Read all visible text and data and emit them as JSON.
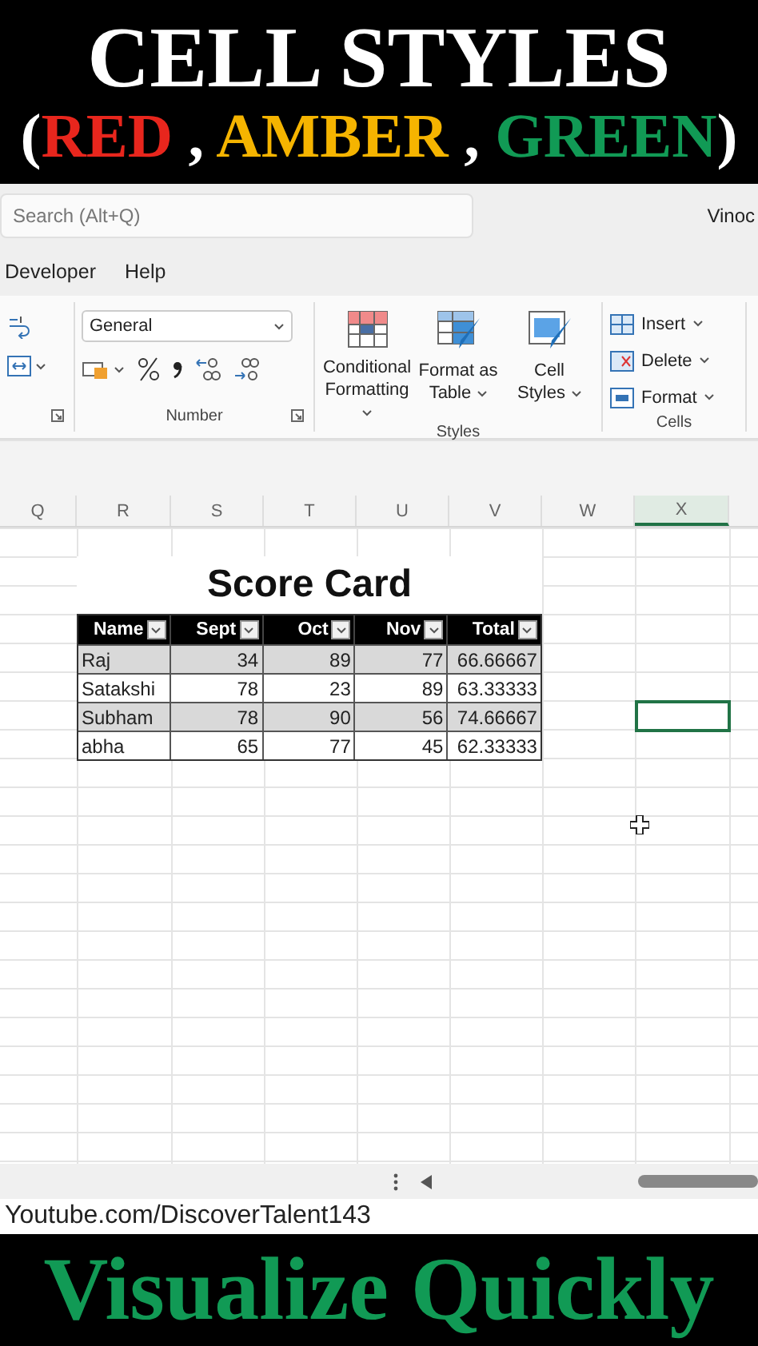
{
  "banner": {
    "title": "CELL STYLES",
    "subtitle": [
      {
        "text": "(",
        "color": "#ffffff"
      },
      {
        "text": "RED",
        "color": "#e8261d"
      },
      {
        "text": " , ",
        "color": "#ffffff"
      },
      {
        "text": "AMBER",
        "color": "#f5b400"
      },
      {
        "text": " , ",
        "color": "#ffffff"
      },
      {
        "text": "GREEN",
        "color": "#119a55"
      },
      {
        "text": ")",
        "color": "#ffffff"
      }
    ]
  },
  "search": {
    "placeholder": "Search (Alt+Q)"
  },
  "user": "Vinoc",
  "menu": [
    {
      "label": "Developer"
    },
    {
      "label": "Help"
    }
  ],
  "ribbon": {
    "number_format": "General",
    "number_label": "Number",
    "styles_label": "Styles",
    "cells_label": "Cells",
    "styles_buttons": [
      {
        "kind": "conditional",
        "lines": [
          "Conditional",
          "Formatting"
        ]
      },
      {
        "kind": "table",
        "lines": [
          "Format as",
          "Table"
        ]
      },
      {
        "kind": "cell",
        "lines": [
          "Cell",
          "Styles"
        ]
      }
    ],
    "cells_buttons": [
      {
        "kind": "insert",
        "label": "Insert"
      },
      {
        "kind": "delete",
        "label": "Delete"
      },
      {
        "kind": "format",
        "label": "Format"
      }
    ]
  },
  "columns": [
    {
      "label": "Q",
      "selected": false
    },
    {
      "label": "R",
      "selected": false
    },
    {
      "label": "S",
      "selected": false
    },
    {
      "label": "T",
      "selected": false
    },
    {
      "label": "U",
      "selected": false
    },
    {
      "label": "V",
      "selected": false
    },
    {
      "label": "W",
      "selected": false
    },
    {
      "label": "X",
      "selected": true
    }
  ],
  "sheet": {
    "title": "Score Card",
    "table": {
      "columns": [
        "Name",
        "Sept",
        "Oct",
        "Nov",
        "Total"
      ],
      "rows": [
        {
          "banded": true,
          "cells": [
            "Raj",
            "34",
            "89",
            "77",
            "66.66667"
          ]
        },
        {
          "banded": false,
          "cells": [
            "Satakshi",
            "78",
            "23",
            "89",
            "63.33333"
          ]
        },
        {
          "banded": true,
          "cells": [
            "Subham",
            "78",
            "90",
            "56",
            "74.66667"
          ]
        },
        {
          "banded": false,
          "cells": [
            "abha",
            "65",
            "77",
            "45",
            "62.33333"
          ]
        }
      ]
    }
  },
  "link": "Youtube.com/DiscoverTalent143",
  "footer": "Visualize Quickly"
}
